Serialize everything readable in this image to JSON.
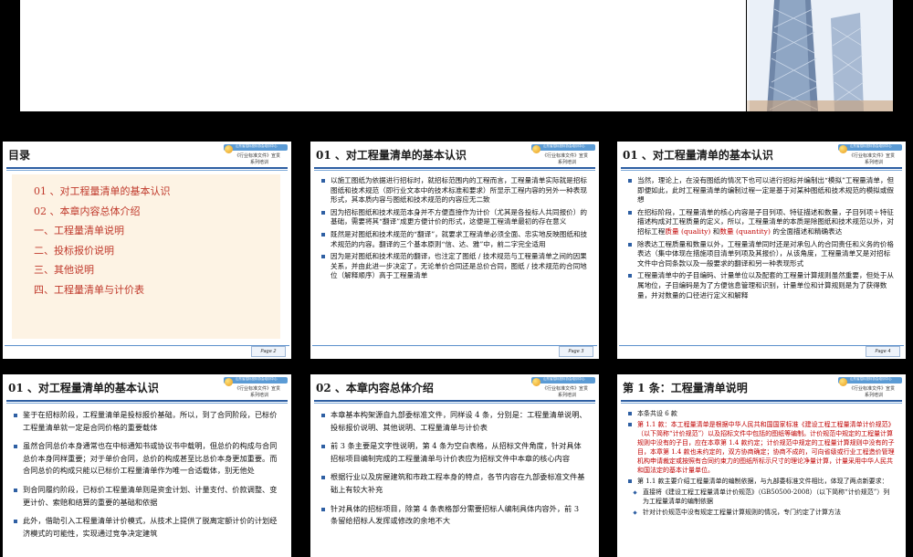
{
  "slides": {
    "s2": {
      "title": "目录",
      "page": "Page 2",
      "toc": [
        "01 、对工程量清单的基本认识",
        "02 、本章内容总体介绍",
        "一、工程量清单说明",
        "二、投标报价说明",
        "三、其他说明",
        "四、工程量清单与计价表"
      ]
    },
    "s3": {
      "title": "01 、对工程量清单的基本认识",
      "page": "Page 3",
      "bullets": [
        "以施工图纸为依据进行招标时，就招标范围内的工程而言，工程量清单实际就是招标图纸和技术规范（即行业文本中的技术标准和要求）所显示工程内容的另外一种表现形式，其本质内容与图纸和技术规范的内容应无二致",
        "因为招标图纸和技术规范本身并不方便直接作为计价（尤其是各投标人共同报价）的基础，需要将其“翻译”成更方便计价的形式，这便是工程清单最初的存在意义",
        "既然是对图纸和技术规范的“翻译”，就要求工程清单必须全面、忠实地反映图纸和技术规范的内容。翻译的三个基本原则“信、达、雅”中，前二字完全适用",
        "因为是对图纸和技术规范的翻译，也注定了图纸 / 技术规范与工程量清单之间的因果关系，并由此进一步决定了，无论单价合同还是总价合同，图纸 / 技术规范的合同地位（解释顺序）高于工程量清单"
      ]
    },
    "s4": {
      "title": "01 、对工程量清单的基本认识",
      "page": "Page 4",
      "b1": "当然，理论上，在没有图纸的情况下也可以进行招标并编制出“模拟”工程量清单，但即便如此，此时工程量清单的编制过程一定是基于对某种图纸和技术规范的模拟或假想",
      "b2_pre": "在招标阶段，工程量清单的核心内容是子目列项、特征描述和数量，子目列项＋特征描述构成对工程质量的定义，所以，工程量清单的本质是除图纸和技术规范以外，对招标工程",
      "b2_q1": "质量 (quality)",
      "b2_and": " 和",
      "b2_q2": "数量 (quantity)",
      "b2_post": " 的全面描述和精确表达",
      "b3": "除表达工程质量和数量以外，工程量清单同时还是对承包人的合同责任和义务的价格表达（集中体现在措施项目清单列项及其报价），从该角度，工程量清单又是对招标文件中合同条款以及一般要求的翻译和另一种表现形式",
      "b4": "工程量清单中的子目编码、计量单位以及配套的工程量计算规则虽然重要，但处于从属地位，子目编码是为了方便信息管理和识别，计量单位和计算规则是为了获得数量，并对数量的口径进行定义和解释"
    },
    "s5": {
      "title": "01 、对工程量清单的基本认识",
      "bullets": [
        "鉴于在招标阶段，工程量清单是投标报价基础，所以，到了合同阶段，已标价工程量清单就一定是合同价格的重要载体",
        "虽然合同总价本身通常也在中标通知书或协议书中载明，但总价的构成与合同总价本身同样重要；对于单价合同，总价的构成甚至比总价本身更加重要。而合同总价的构成只能以已标价工程量清单作为唯一合适载体，别无他处",
        "到合同履约阶段，已标价工程量清单则是资金计划、计量支付、价款调整、变更计价、索赔和结算的重要的基础和依据",
        "此外，借助引入工程量清单计价模式，从技术上提供了脱离定额计价的计划经济模式的可能性，实现通过竞争决定建筑"
      ]
    },
    "s6": {
      "title": "02 、本章内容总体介绍",
      "bullets": [
        "本章基本构架源自九部委标准文件，同样设 4 条，分别是：工程量清单说明、投标报价说明、其他说明、工程量清单与计价表",
        "前 3 条主要是文字性说明，第 4 条为空白表格，从招标文件角度，针对具体招标项目编制完成的工程量清单与计价表应为招标文件中本章的核心内容",
        "根据行业以及房屋建筑和市政工程本身的特点，各节内容在九部委标准文件基础上有较大补充",
        "针对具体的招标项目，除第 4 条表格部分需要招标人编制具体内容外，前 3 条留给招标人发挥或修改的余地不大"
      ]
    },
    "s7": {
      "title": "第 1 条：工程量清单说明",
      "b1": "本条共设 6 款",
      "b2": "第 1.1 款：本工程量清单是根据中华人民共和国国家标准《建设工程工程量清单计价规范》（以下简称“计价规范”）以及招标文件中包括的图纸等编制。计价规范中规定的工程量计算规则中没有的子目，应在本章第 1.4 款约定；计价规范中规定的工程量计算规则中没有的子目，本章第 1.4 款也未约定的，双方协商确定；协商不成的，可向省级或行业工程造价管理机构申请裁定或按照有合同约束力的图纸所标示尺寸的理论净量计算，计量采用中华人民共和国法定的基本计量单位。",
      "b3": "第 1.1 款主要介绍工程量清单的编制依据，与九部委标准文件相比，体现了两点新要求：",
      "b4": "直接将《建设工程工程量清单计价规范》（GB50500-2008）（以下简称“计价规范”）列为工程量清单的编制依据",
      "b5": "针对计价规范中没有规定工程量计算规则的情况，专门约定了计算方法"
    }
  },
  "logo": {
    "top_text": "山东省招标投标协会培训中心",
    "line1": "《行业标准文件》宣贯",
    "line2": "系列培训"
  },
  "colors": {
    "accent": "#2e5fa3",
    "highlight_red": "#c00000",
    "toc_text": "#c0392b"
  }
}
